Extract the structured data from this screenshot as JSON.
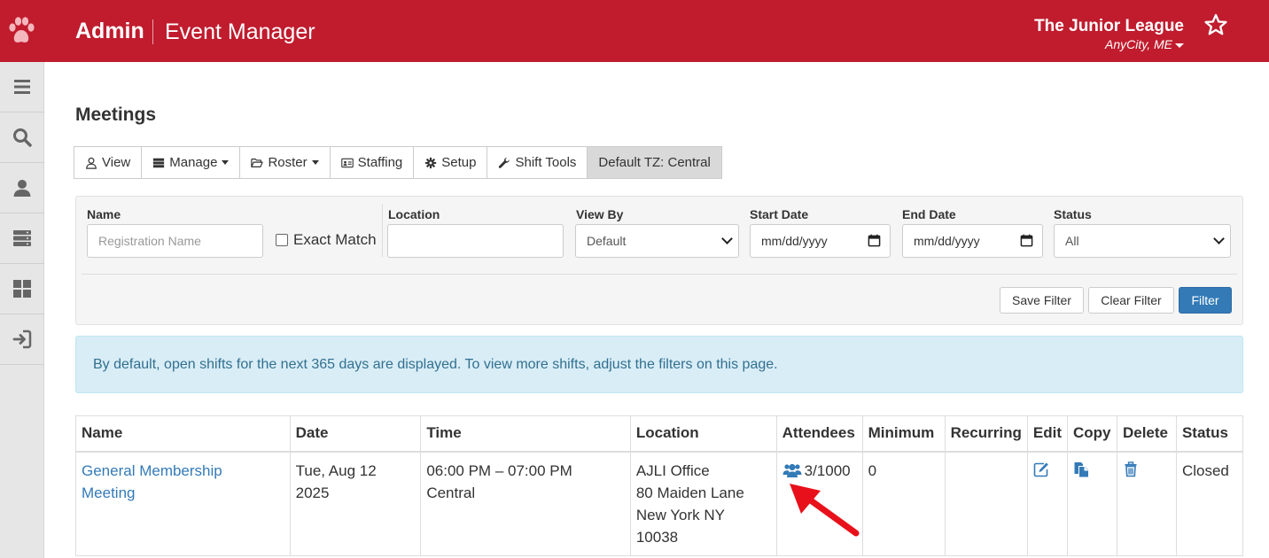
{
  "header": {
    "brand": "Admin",
    "app_name": "Event Manager",
    "org_name": "The Junior League",
    "org_city": "AnyCity, ME"
  },
  "sidebar": {
    "items": [
      {
        "icon": "menu-icon"
      },
      {
        "icon": "search-icon"
      },
      {
        "icon": "user-icon"
      },
      {
        "icon": "server-icon"
      },
      {
        "icon": "dashboard-icon"
      },
      {
        "icon": "sign-in-icon"
      }
    ]
  },
  "page": {
    "title": "Meetings"
  },
  "tabs": {
    "view": "View",
    "manage": "Manage",
    "roster": "Roster",
    "staffing": "Staffing",
    "setup": "Setup",
    "shift_tools": "Shift Tools",
    "timezone": "Default TZ: Central"
  },
  "filter": {
    "name_label": "Name",
    "name_placeholder": "Registration Name",
    "exact_match_label": "Exact Match",
    "location_label": "Location",
    "view_by_label": "View By",
    "view_by_value": "Default",
    "start_date_label": "Start Date",
    "start_date_placeholder": "mm/dd/yyyy",
    "end_date_label": "End Date",
    "end_date_placeholder": "mm/dd/yyyy",
    "status_label": "Status",
    "status_value": "All",
    "save_filter": "Save Filter",
    "clear_filter": "Clear Filter",
    "filter": "Filter"
  },
  "alert": {
    "message": "By default, open shifts for the next 365 days are displayed. To view more shifts, adjust the filters on this page."
  },
  "table": {
    "headers": {
      "name": "Name",
      "date": "Date",
      "time": "Time",
      "location": "Location",
      "attendees": "Attendees",
      "minimum": "Minimum",
      "recurring": "Recurring",
      "edit": "Edit",
      "copy": "Copy",
      "delete": "Delete",
      "status": "Status"
    },
    "rows": [
      {
        "name_line1": "General Membership",
        "name_line2": "Meeting",
        "date_line1": "Tue, Aug 12",
        "date_line2": "2025",
        "time": "06:00 PM – 07:00 PM Central",
        "location_line1": "AJLI Office",
        "location_line2": "80 Maiden Lane",
        "location_line3": "New York NY",
        "location_line4": "10038",
        "attendees": "3/1000",
        "minimum": "0",
        "recurring": "",
        "status": "Closed"
      }
    ]
  },
  "colors": {
    "brand_red": "#c01c2e",
    "link_blue": "#337ab7",
    "alert_bg": "#d9edf7",
    "arrow_red": "#e8101a"
  }
}
